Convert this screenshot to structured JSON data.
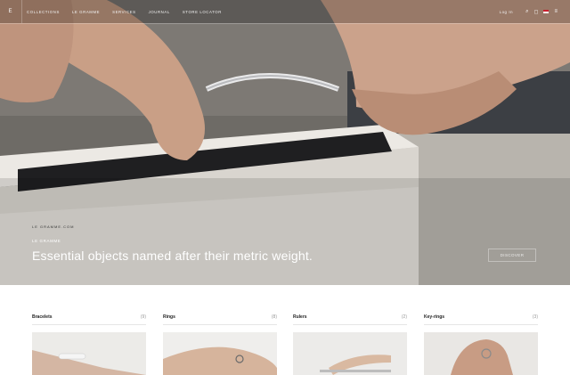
{
  "nav": {
    "logo": "E",
    "links": [
      "Collections",
      "Le Gramme",
      "Services",
      "Journal",
      "Store Locator"
    ],
    "login": "Log In",
    "icons": [
      "search-icon",
      "cart-icon",
      "flag-icon",
      "menu-icon"
    ]
  },
  "hero": {
    "eyebrow": "Le Gramme",
    "headline": "Essential objects named after their metric weight.",
    "box_print": "LE GRAMME.COM",
    "cta": "Discover"
  },
  "categories": [
    {
      "title": "Bracelets",
      "count": "(9)"
    },
    {
      "title": "Rings",
      "count": "(8)"
    },
    {
      "title": "Rulers",
      "count": "(2)"
    },
    {
      "title": "Key-rings",
      "count": "(3)"
    }
  ]
}
